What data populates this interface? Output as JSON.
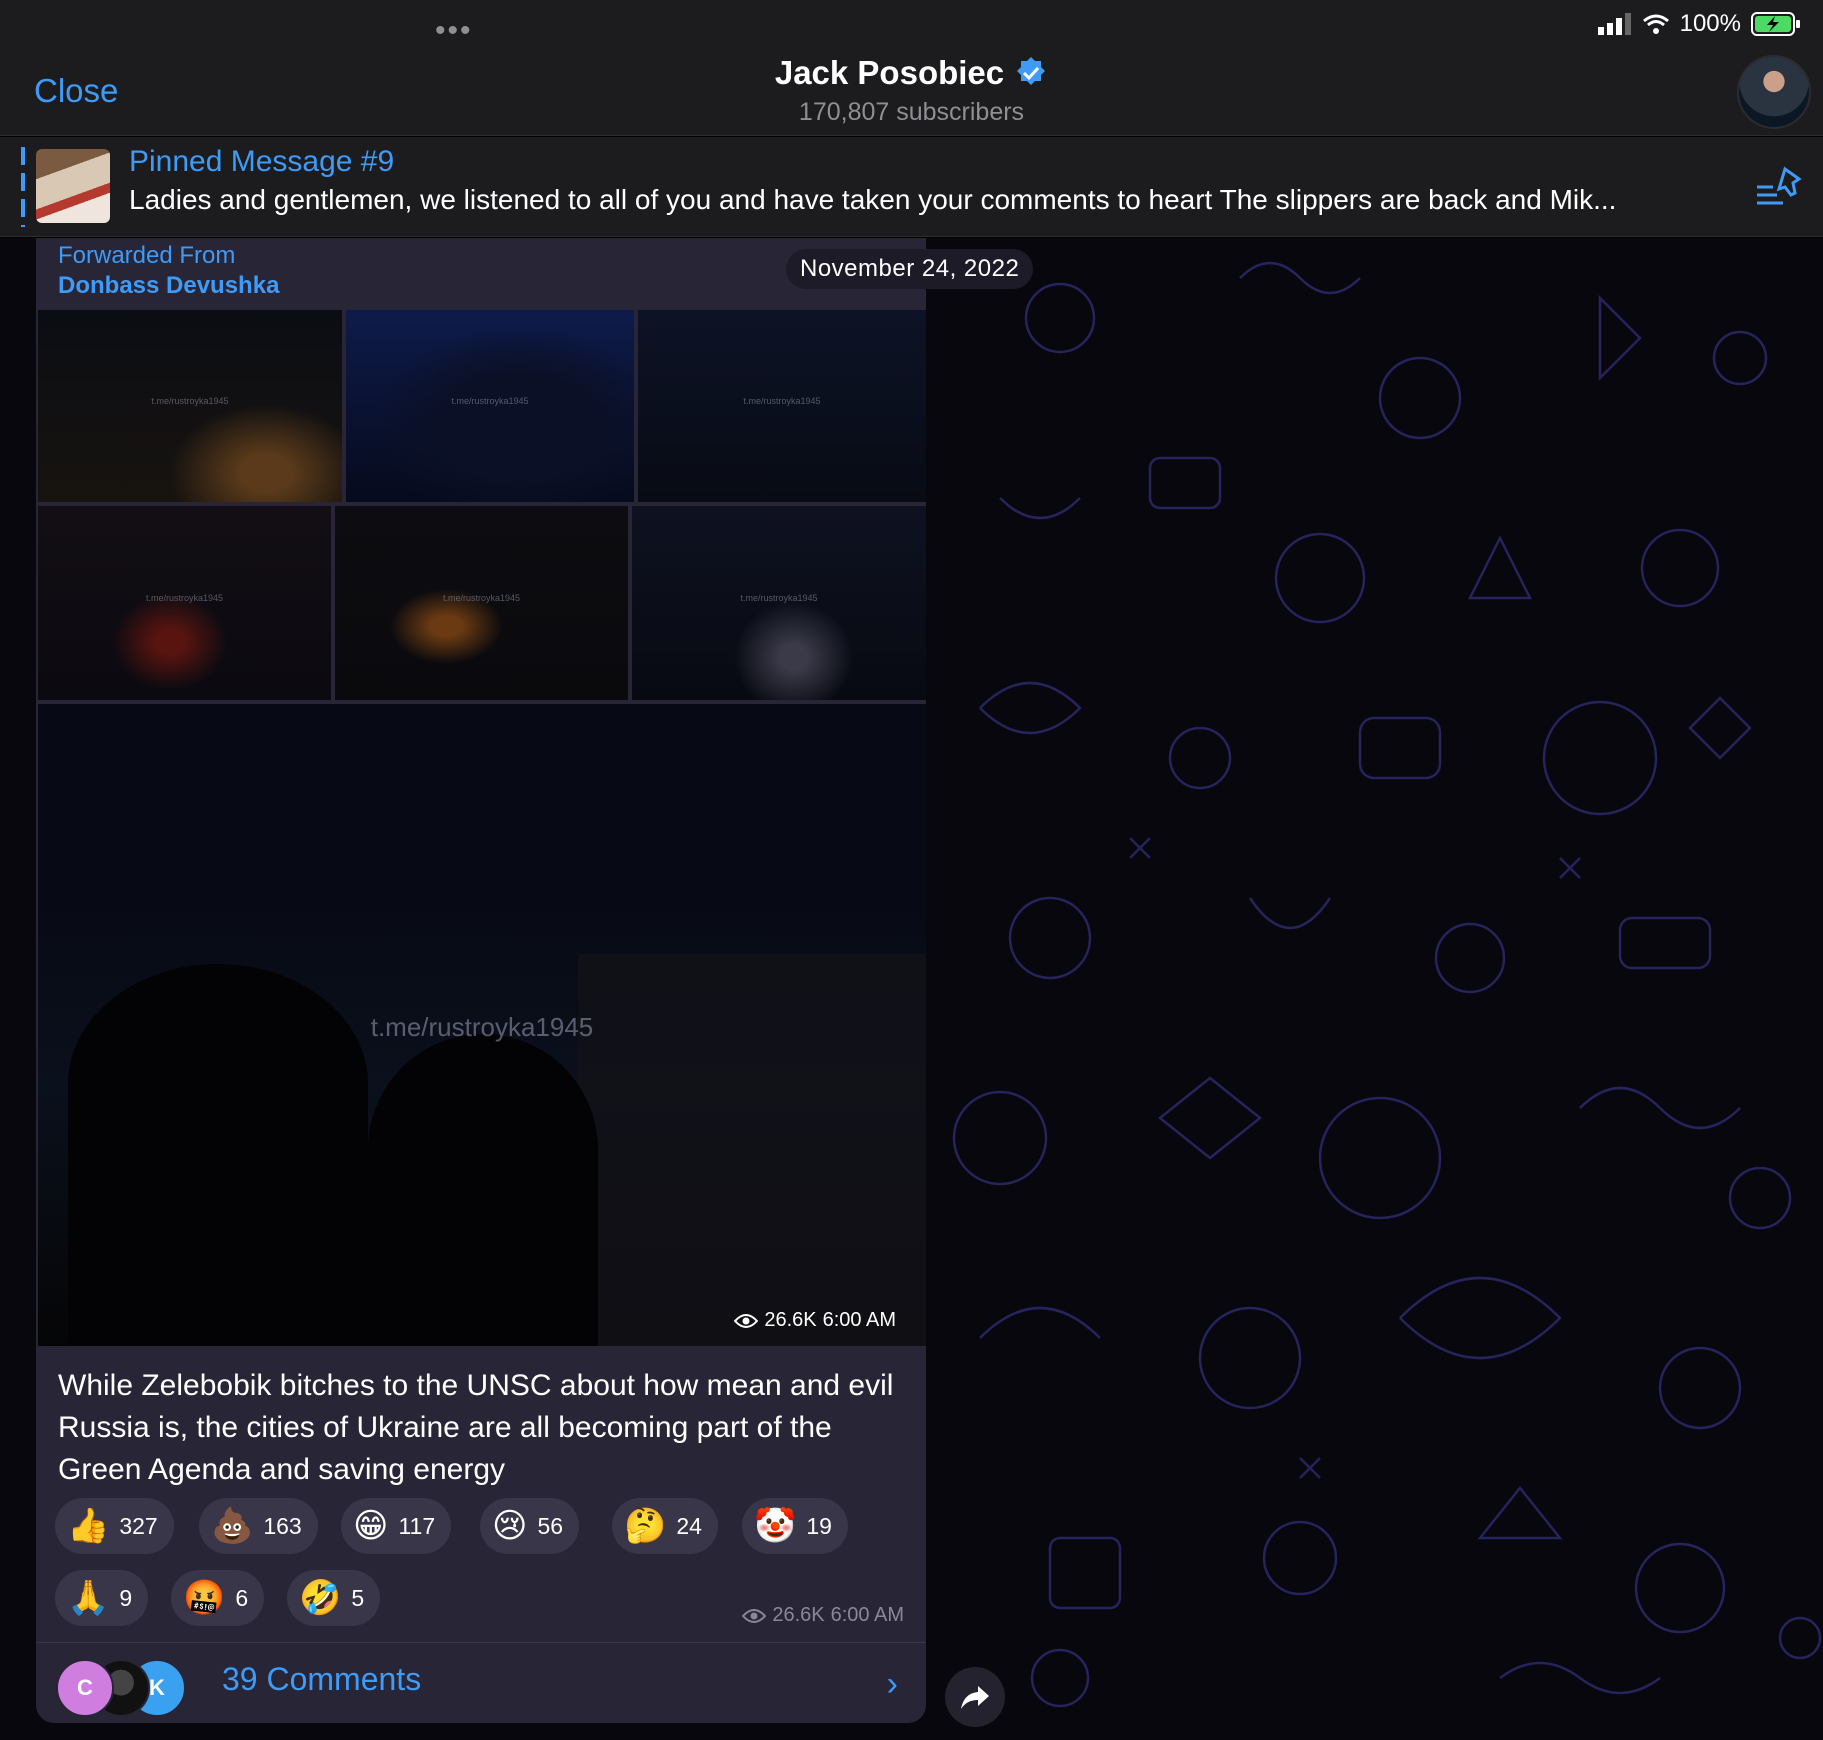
{
  "header": {
    "close_label": "Close",
    "channel_name": "Jack Posobiec",
    "subscribers": "170,807 subscribers",
    "verified": true
  },
  "status_bar": {
    "battery": "100%"
  },
  "pinned": {
    "title": "Pinned Message #9",
    "text": "Ladies and gentlemen, we listened to all of you and have taken your comments to heart The slippers are back and Mik..."
  },
  "date_pill": "November 24, 2022",
  "message": {
    "forwarded_label": "Forwarded From",
    "forwarded_from": "Donbass Devushka",
    "watermark": "t.me/rustroyka1945",
    "watermark_small": "t.me/rustroyka1945",
    "views": "26.6K",
    "time": "6:00 AM",
    "text": "While Zelebobik bitches to the UNSC about how mean and evil Russia is, the cities of Ukraine are all becoming part of the Green Agenda and saving energy"
  },
  "reactions": [
    {
      "emoji": "👍",
      "count": "327"
    },
    {
      "emoji": "💩",
      "count": "163"
    },
    {
      "emoji": "😁",
      "count": "117"
    },
    {
      "emoji": "😢",
      "count": "56"
    },
    {
      "emoji": "🤔",
      "count": "24"
    },
    {
      "emoji": "🤡",
      "count": "19"
    },
    {
      "emoji": "🙏",
      "count": "9"
    },
    {
      "emoji": "🤬",
      "count": "6"
    },
    {
      "emoji": "🤣",
      "count": "5"
    }
  ],
  "comments": {
    "label": "39 Comments",
    "avatars": [
      "C",
      "",
      "K"
    ]
  },
  "colors": {
    "accent": "#3e9bf7",
    "bubble": "#282536",
    "bar": "#1c1c1e"
  }
}
